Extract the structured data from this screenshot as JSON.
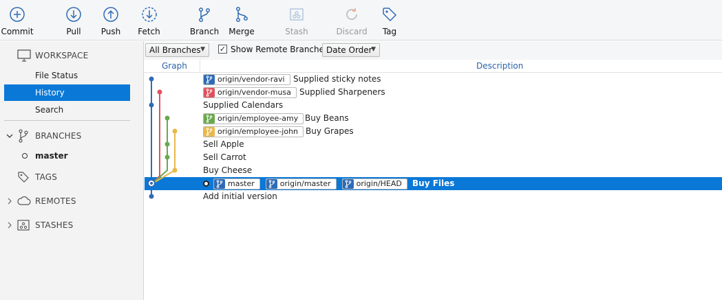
{
  "toolbar": {
    "commit": "Commit",
    "pull": "Pull",
    "push": "Push",
    "fetch": "Fetch",
    "branch": "Branch",
    "merge": "Merge",
    "stash": "Stash",
    "discard": "Discard",
    "tag": "Tag"
  },
  "sidebar": {
    "workspace": "WORKSPACE",
    "file_status": "File Status",
    "history": "History",
    "search": "Search",
    "branches": "BRANCHES",
    "master": "master",
    "tags": "TAGS",
    "remotes": "REMOTES",
    "stashes": "STASHES"
  },
  "filters": {
    "branches": "All Branches",
    "show_remote": "Show Remote Branches",
    "show_remote_checked": true,
    "order": "Date Order"
  },
  "columns": {
    "graph": "Graph",
    "description": "Description"
  },
  "commits": [
    {
      "tags": [
        {
          "label": "origin/vendor-ravi",
          "color": "#2e6bb5"
        }
      ],
      "message": "Supplied sticky notes"
    },
    {
      "tags": [
        {
          "label": "origin/vendor-musa",
          "color": "#e0525e"
        }
      ],
      "message": "Supplied Sharpeners"
    },
    {
      "tags": [],
      "message": "Supplied Calendars"
    },
    {
      "tags": [
        {
          "label": "origin/employee-amy",
          "color": "#6aa84f"
        }
      ],
      "message": "Buy Beans"
    },
    {
      "tags": [
        {
          "label": "origin/employee-john",
          "color": "#e8b84a"
        }
      ],
      "message": "Buy Grapes"
    },
    {
      "tags": [],
      "message": "Sell Apple"
    },
    {
      "tags": [],
      "message": "Sell Carrot"
    },
    {
      "tags": [],
      "message": "Buy Cheese"
    },
    {
      "tags": [
        {
          "label": "master",
          "color": "#2e6bb5"
        },
        {
          "label": "origin/master",
          "color": "#2e6bb5"
        },
        {
          "label": "origin/HEAD",
          "color": "#2e6bb5"
        }
      ],
      "message": "Buy Files",
      "selected": true
    },
    {
      "tags": [],
      "message": "Add initial version"
    }
  ],
  "colors": {
    "accent": "#0a78d7",
    "blue": "#2e6bb5",
    "red": "#e0525e",
    "green": "#6aa84f",
    "yellow": "#e8b84a"
  }
}
